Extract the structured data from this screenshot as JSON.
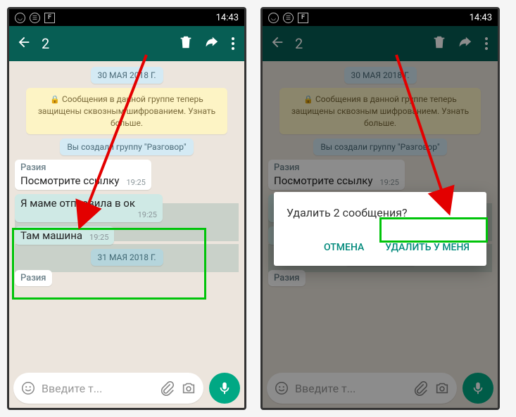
{
  "status": {
    "time": "14:43"
  },
  "header": {
    "selection_count": "2"
  },
  "chat": {
    "date1": "30 МАЯ 2018 Г.",
    "encryption_text": "Сообщения в данной группе теперь защищены сквозным шифрованием. Узнать больше.",
    "system_created": "Вы создали группу \"Разговор\"",
    "messages": [
      {
        "sender": "Разия",
        "text": "Посмотрите ссылку",
        "time": "19:25",
        "selected": false
      },
      {
        "sender": "",
        "text": "Я маме отправила в ок",
        "time": "19:25",
        "selected": true
      },
      {
        "sender": "",
        "text": "Там машина",
        "time": "19:25",
        "selected": true
      }
    ],
    "date2": "31 МАЯ 2018 Г.",
    "sender2": "Разия"
  },
  "input": {
    "placeholder": "Введите т..."
  },
  "dialog": {
    "title": "Удалить 2 сообщения?",
    "cancel": "ОТМЕНА",
    "delete": "УДАЛИТЬ У МЕНЯ"
  }
}
